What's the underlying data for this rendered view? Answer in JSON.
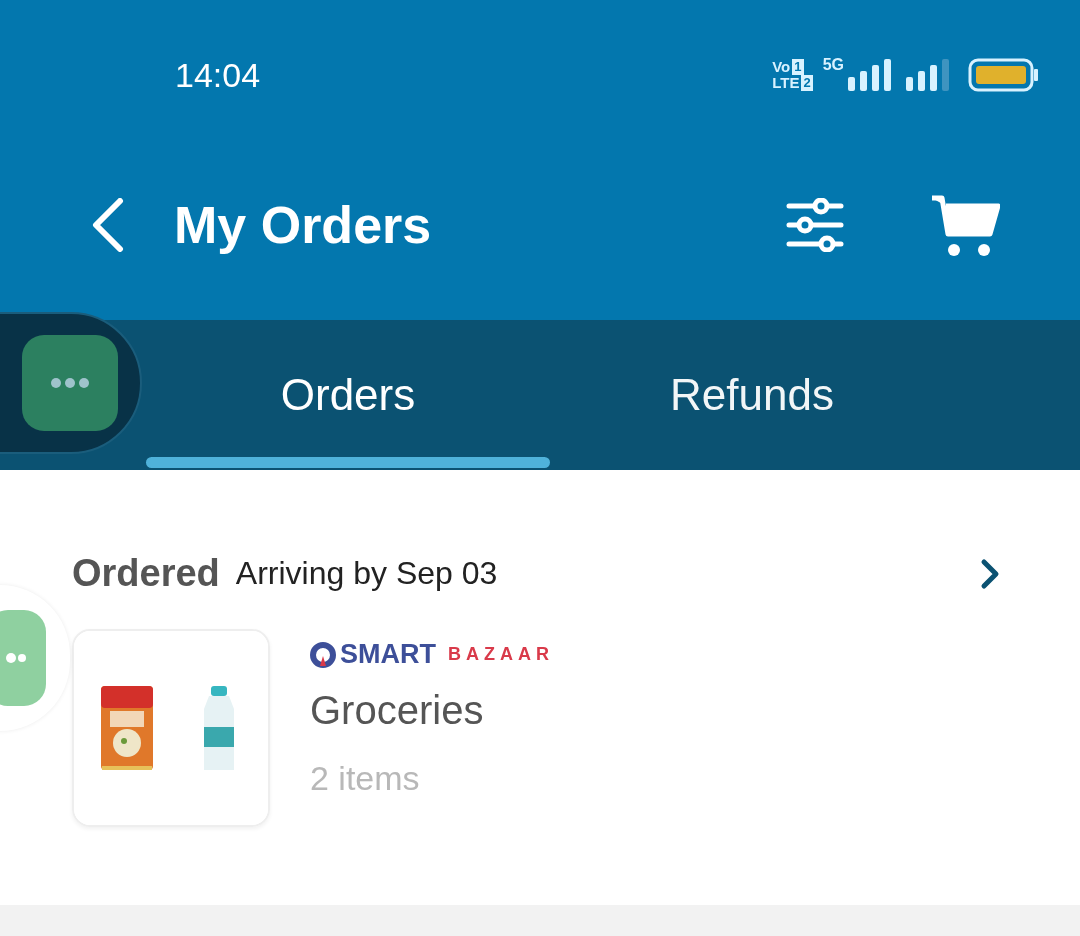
{
  "status_bar": {
    "time": "14:04",
    "sim_labels": [
      "Vo",
      "LTE"
    ],
    "sim_slots": [
      "1",
      "2"
    ],
    "network": "5G"
  },
  "header": {
    "title": "My Orders"
  },
  "tabs": [
    {
      "label": "Orders",
      "selected": true
    },
    {
      "label": "Refunds",
      "selected": false
    }
  ],
  "orders": [
    {
      "status": "Ordered",
      "eta": "Arriving by Sep 03",
      "store": {
        "name": "SMART",
        "suffix": "BAZAAR"
      },
      "category": "Groceries",
      "count": "2 items"
    }
  ]
}
